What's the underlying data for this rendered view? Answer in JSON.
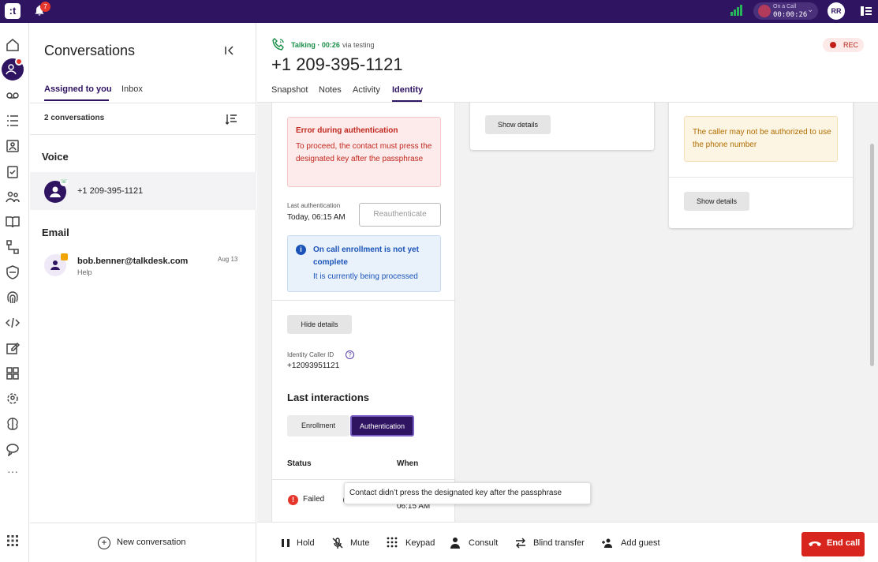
{
  "topbar": {
    "notification_count": "7",
    "call_status_label": "On a Call",
    "call_timer": "00:00:26",
    "user_initials": "RR"
  },
  "conversations": {
    "title": "Conversations",
    "tabs": [
      "Assigned to you",
      "Inbox"
    ],
    "count_label": "2 conversations",
    "sections": {
      "voice": {
        "label": "Voice",
        "items": [
          {
            "number": "+1 209-395-1121"
          }
        ]
      },
      "email": {
        "label": "Email",
        "items": [
          {
            "address": "bob.benner@talkdesk.com",
            "subject": "Help",
            "date": "Aug 13"
          }
        ]
      }
    },
    "new_conversation_label": "New conversation"
  },
  "call_header": {
    "status": "Talking · 00:26",
    "via": "via testing",
    "caller_number": "+1 209-395-1121",
    "rec_label": "REC",
    "tabs": [
      "Snapshot",
      "Notes",
      "Activity",
      "Identity"
    ],
    "active_tab": "Identity"
  },
  "identity": {
    "error_title": "Error during authentication",
    "error_text": "To proceed, the contact must press the designated key after the passphrase",
    "last_auth_label": "Last authentication",
    "last_auth_value": "Today, 06:15 AM",
    "reauth_label": "Reauthenticate",
    "info_title": "On call enrollment is not yet complete",
    "info_text": "It is currently being processed",
    "hide_details_label": "Hide details",
    "caller_id_label": "Identity Caller ID",
    "caller_id_value": "+12093951121",
    "last_interactions_title": "Last interactions",
    "toggle_buttons": [
      "Enrollment",
      "Authentication"
    ],
    "table_headers": [
      "Status",
      "When"
    ],
    "rows": [
      {
        "status": "Failed",
        "when": "06:15 AM"
      }
    ],
    "tooltip": "Contact didn’t press the designated key after the passphrase"
  },
  "card2": {
    "show_details_label": "Show details"
  },
  "card3": {
    "warning_text": "The caller may not be authorized to use the phone number",
    "show_details_label": "Show details"
  },
  "callbar": {
    "hold": "Hold",
    "mute": "Mute",
    "keypad": "Keypad",
    "consult": "Consult",
    "blind_transfer": "Blind transfer",
    "add_guest": "Add guest",
    "end_call": "End call"
  },
  "colors": {
    "brand": "#2e1461",
    "talking": "#1a8f4a",
    "error": "#c0281f",
    "info": "#1b54b8",
    "warning": "#b06d00",
    "end_call": "#d8261e"
  }
}
